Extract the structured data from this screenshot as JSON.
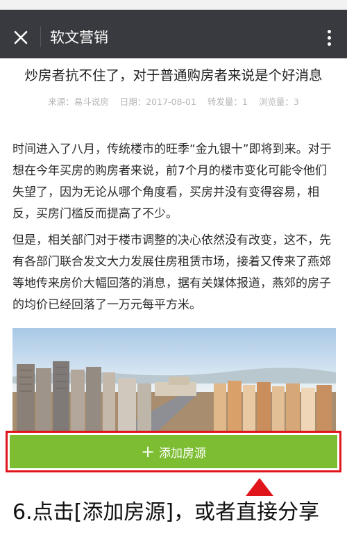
{
  "topbar": {
    "title": "软文营销",
    "close_icon": "close-icon",
    "more_icon": "more-vertical-icon"
  },
  "article": {
    "title": "炒房者抗不住了，对于普通购房者来说是个好消息",
    "meta": {
      "source": "来源：易斗说房",
      "date": "日期：2017-08-01",
      "shares": "转发量：1",
      "views": "浏览量：3"
    },
    "paragraphs": [
      "时间进入了八月，传统楼市的旺季“金九银十”即将到来。对于想在今年买房的购房者来说，前7个月的楼市变化可能令他们失望了，因为无论从哪个角度看，买房并没有变得容易，相反，买房门槛反而提高了不少。",
      "但是，相关部门对于楼市调整的决心依然没有改变，这不，先有各部门联合发文大力发展住房租赁市场，接着又传来了燕郊等地传来房价大幅回落的消息，据有关媒体报道，燕郊的房子的均价已经回落了一万元每平方米。"
    ]
  },
  "actions": {
    "add_listing_label": "添加房源",
    "plus_icon": "plus-icon"
  },
  "instruction": "6.点击[添加房源]，或者直接分享",
  "colors": {
    "topbar": "#393a3f",
    "button_green": "#7cbd31",
    "highlight_red": "#e0141b"
  }
}
